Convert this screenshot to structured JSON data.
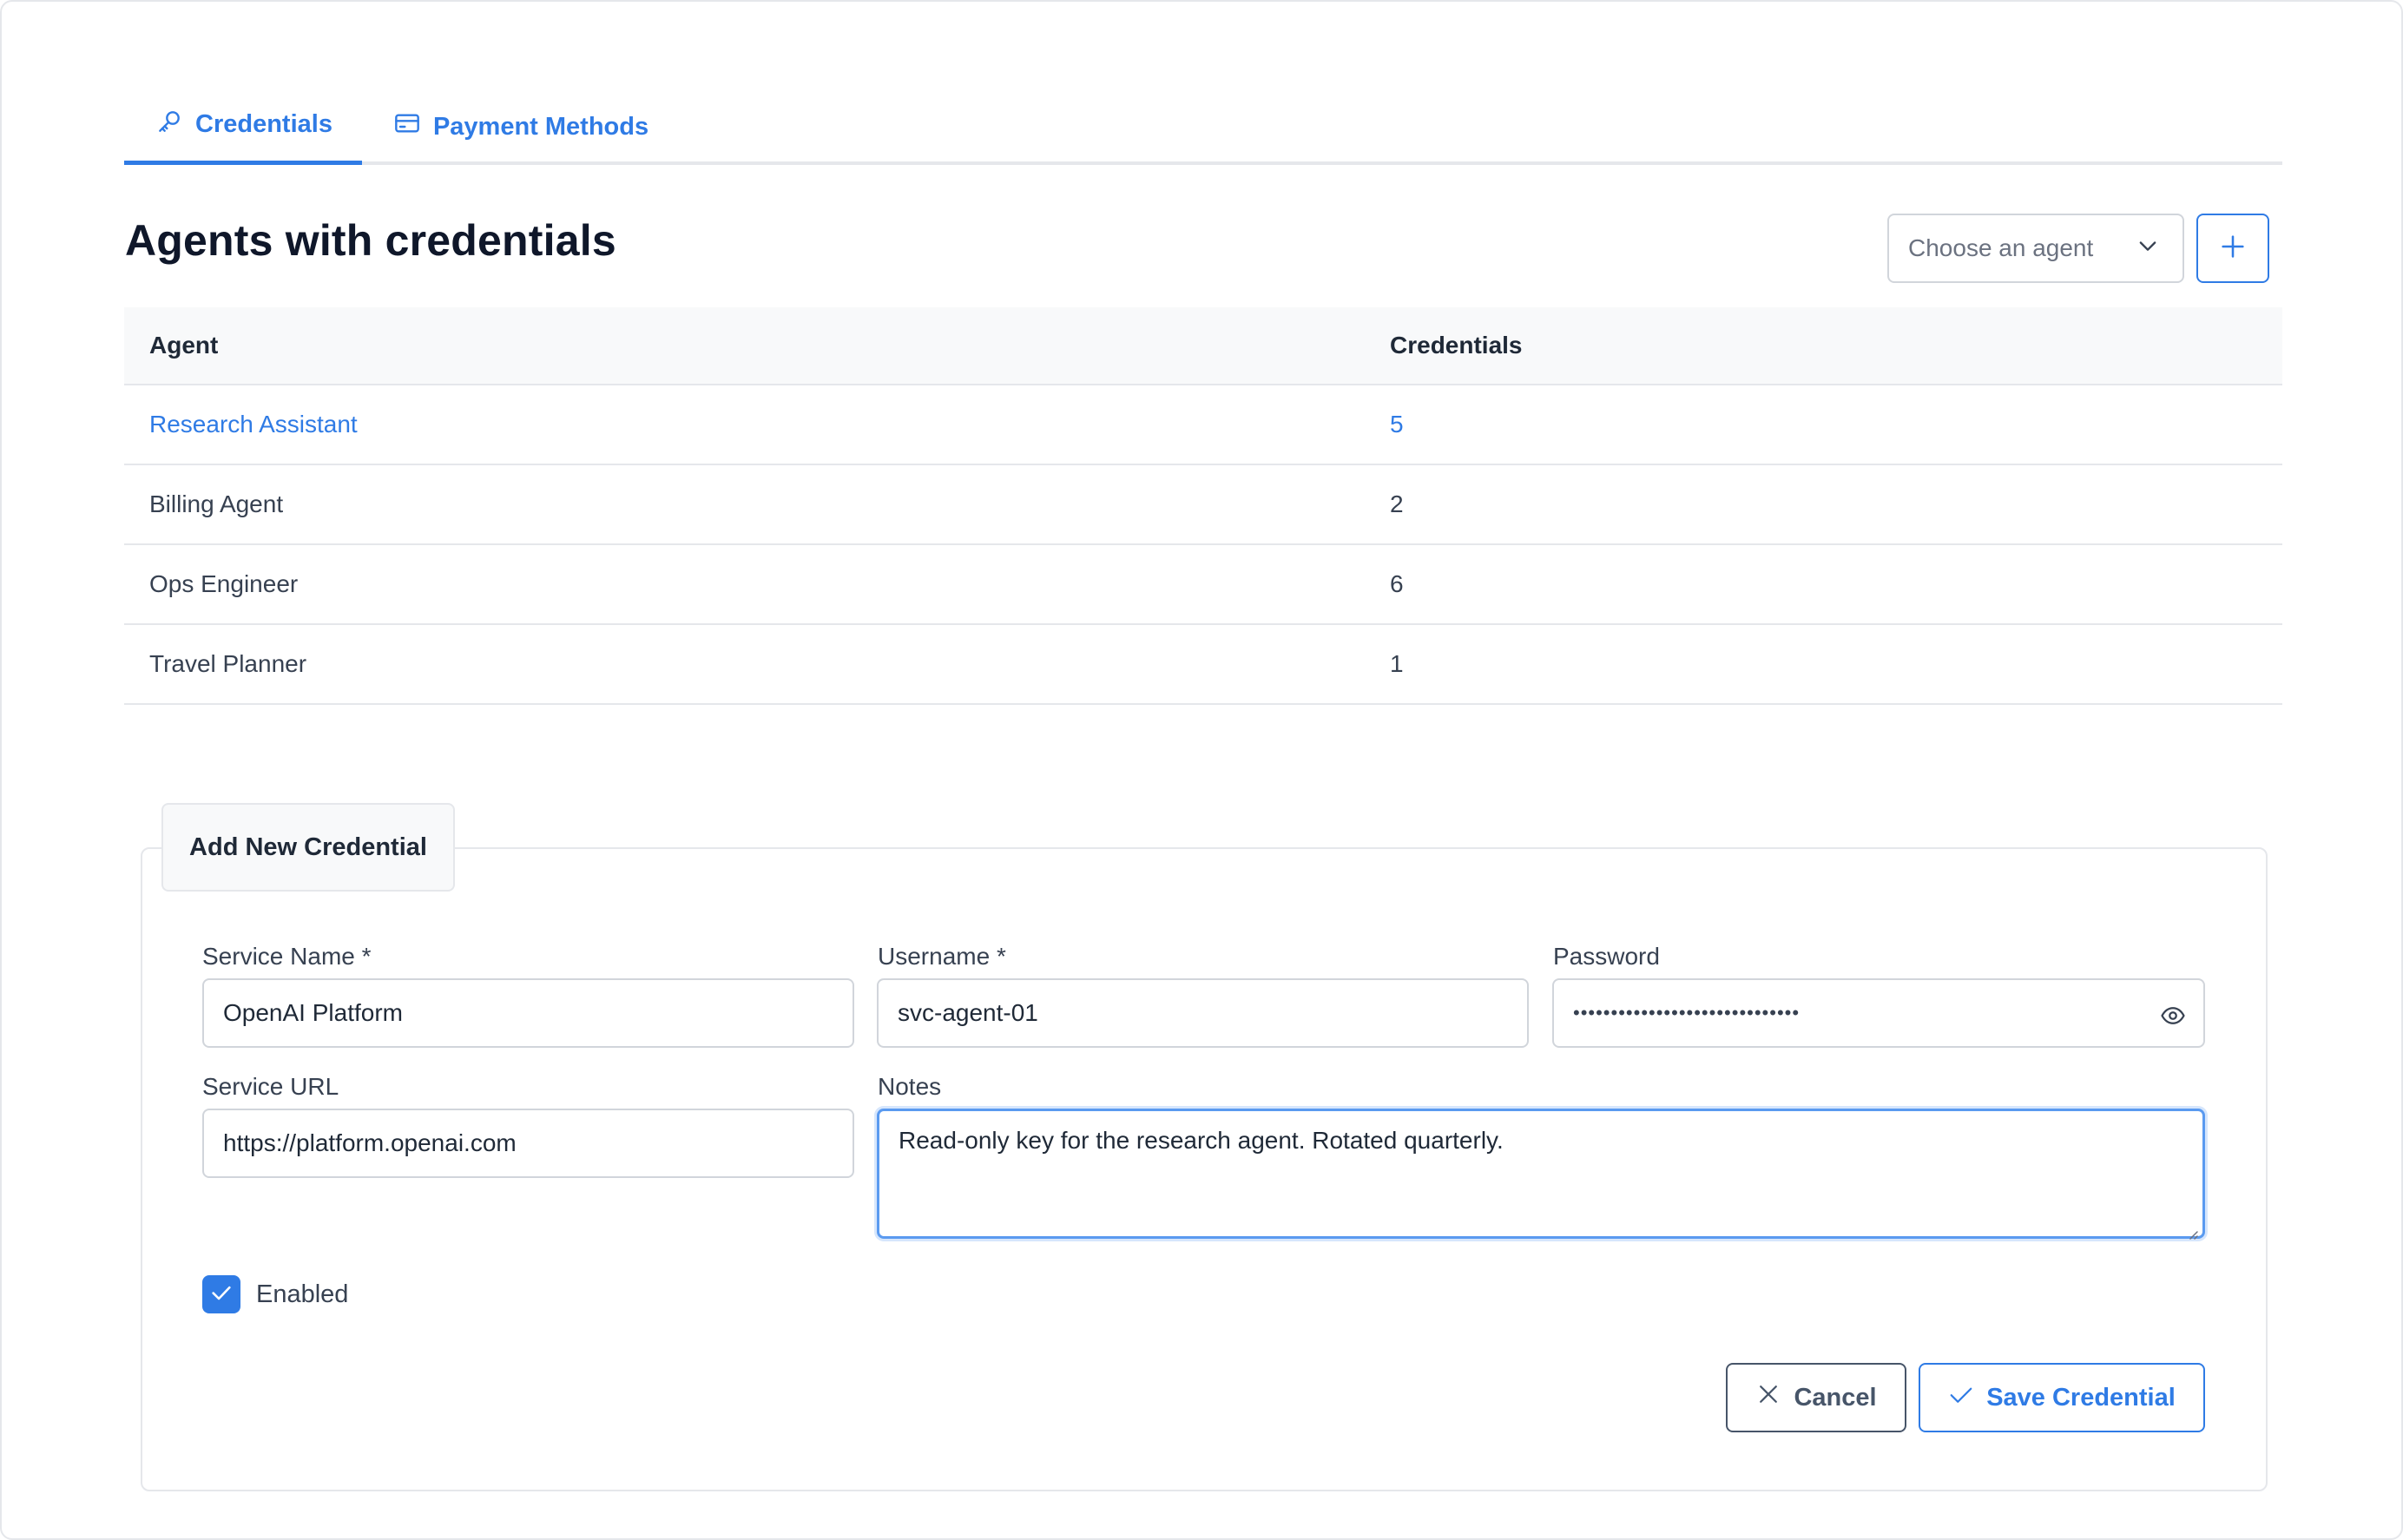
{
  "tabs": [
    {
      "label": "Credentials",
      "icon": "key-icon",
      "active": true
    },
    {
      "label": "Payment Methods",
      "icon": "credit-card-icon",
      "active": false
    }
  ],
  "page": {
    "title": "Agents with credentials",
    "agent_select_placeholder": "Choose an agent"
  },
  "table": {
    "headers": {
      "agent": "Agent",
      "credentials": "Credentials"
    },
    "rows": [
      {
        "agent": "Research Assistant",
        "credentials": "5"
      },
      {
        "agent": "Billing Agent",
        "credentials": "2"
      },
      {
        "agent": "Ops Engineer",
        "credentials": "6"
      },
      {
        "agent": "Travel Planner",
        "credentials": "1"
      }
    ]
  },
  "form": {
    "legend": "Add New Credential",
    "service_name": {
      "label": "Service Name *",
      "value": "OpenAI Platform"
    },
    "username": {
      "label": "Username *",
      "value": "svc-agent-01"
    },
    "password": {
      "label": "Password",
      "value": "••••••••••••••••••••••••••••••"
    },
    "service_url": {
      "label": "Service URL",
      "value": "https://platform.openai.com"
    },
    "notes": {
      "label": "Notes",
      "value": "Read-only key for the research agent. Rotated quarterly."
    },
    "enabled": {
      "label": "Enabled",
      "checked": true
    },
    "cancel_label": "Cancel",
    "save_label": "Save Credential"
  },
  "colors": {
    "accent": "#2f7be5",
    "border": "#e5e7eb",
    "text": "#1f2937"
  }
}
